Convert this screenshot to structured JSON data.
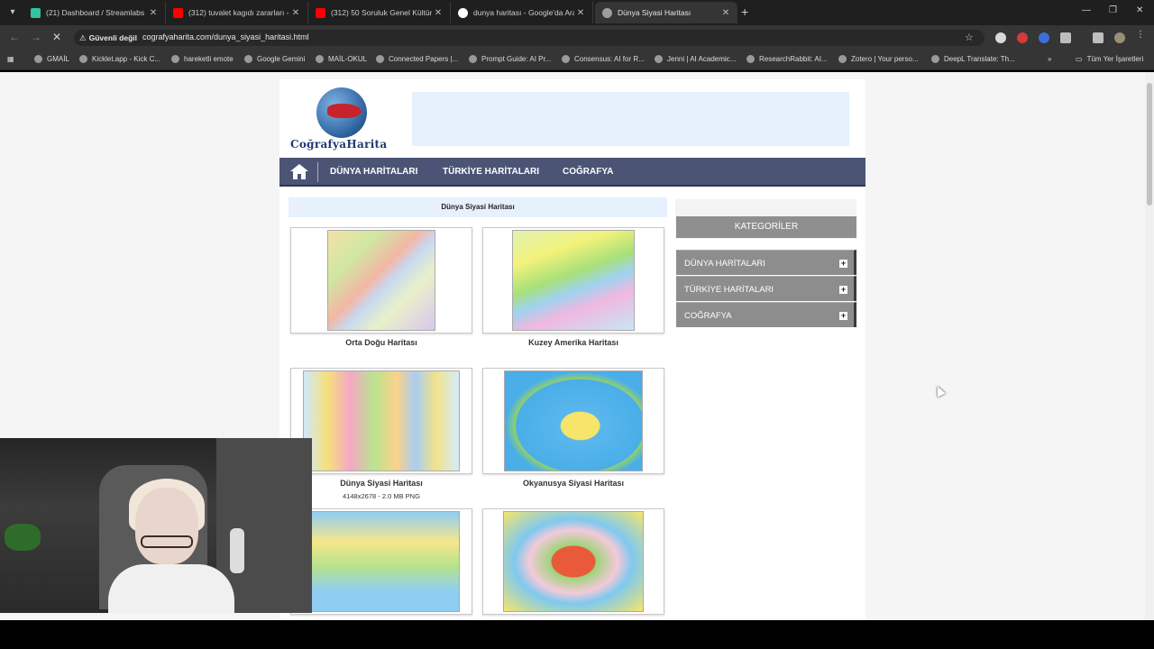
{
  "browser": {
    "tabs": [
      {
        "title": "(21) Dashboard / Streamlabs",
        "icon_color": "#31c3a2",
        "active": false
      },
      {
        "title": "(312) tuvalet kagıdı zararları - Y",
        "icon_color": "#ff0000",
        "active": false
      },
      {
        "title": "(312) 50 Soruluk Genel Kültür T",
        "icon_color": "#ff0000",
        "active": false
      },
      {
        "title": "dunya haritası - Google'da Ara",
        "icon_color": "#ffffff",
        "active": false
      },
      {
        "title": "Dünya Siyasi Haritası",
        "icon_color": "#9e9e9e",
        "active": true
      }
    ],
    "security_label": "Güvenli değil",
    "url": "cografyaharita.com/dunya_siyasi_haritasi.html",
    "bookmarks": [
      "GMAİL",
      "Kicklet.app - Kick C...",
      "hareketli emote",
      "Google Gemini",
      "MAİL-OKUL",
      "Connected Papers |...",
      "Prompt Guide: AI Pr...",
      "Consensus: AI for R...",
      "Jenni | AI Academic...",
      "ResearchRabbit: AI...",
      "Zotero | Your perso...",
      "DeepL Translate: Th..."
    ],
    "all_bookmarks": "Tüm Yer İşaretleri"
  },
  "site": {
    "logo_text": "CoğrafyaHarita",
    "menu": [
      "DÜNYA HARİTALARI",
      "TÜRKİYE HARİTALARI",
      "COĞRAFYA"
    ],
    "breadcrumb": "Dünya Siyasi Haritası",
    "maps": [
      {
        "title": "Orta Doğu Haritası",
        "sub": ""
      },
      {
        "title": "Kuzey Amerika Haritası",
        "sub": ""
      },
      {
        "title": "Dünya Siyasi Haritası",
        "sub": "4148x2678 - 2.0 MB PNG"
      },
      {
        "title": "Okyanusya Siyasi Haritası",
        "sub": ""
      }
    ],
    "sidebar": {
      "heading": "KATEGORİLER",
      "items": [
        "DÜNYA HARİTALARI",
        "TÜRKİYE HARİTALARI",
        "COĞRAFYA"
      ]
    }
  }
}
